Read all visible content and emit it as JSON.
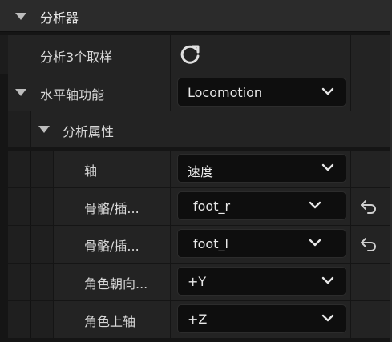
{
  "section": {
    "title": "分析器"
  },
  "rows": {
    "analyze_samples": {
      "label": "分析3个取样"
    },
    "horizontal_axis": {
      "label": "水平轴功能",
      "value": "Locomotion"
    },
    "analysis_props": {
      "label": "分析属性"
    },
    "axis": {
      "label": "轴",
      "value": "速度"
    },
    "bone_r": {
      "label": "骨骼/插...",
      "value": "foot_r"
    },
    "bone_l": {
      "label": "骨骼/插...",
      "value": "foot_l"
    },
    "char_facing": {
      "label": "角色朝向...",
      "value": "+Y"
    },
    "char_up": {
      "label": "角色上轴",
      "value": "+Z"
    }
  },
  "icons": {
    "collapse": "triangle-down-icon",
    "refresh": "refresh-icon",
    "dropdown": "chevron-down-icon",
    "reset": "reset-arrow-icon"
  },
  "colors": {
    "background": "#151515",
    "header": "#2b2b2b",
    "row": "#232323",
    "field": "#0e0e0e"
  }
}
